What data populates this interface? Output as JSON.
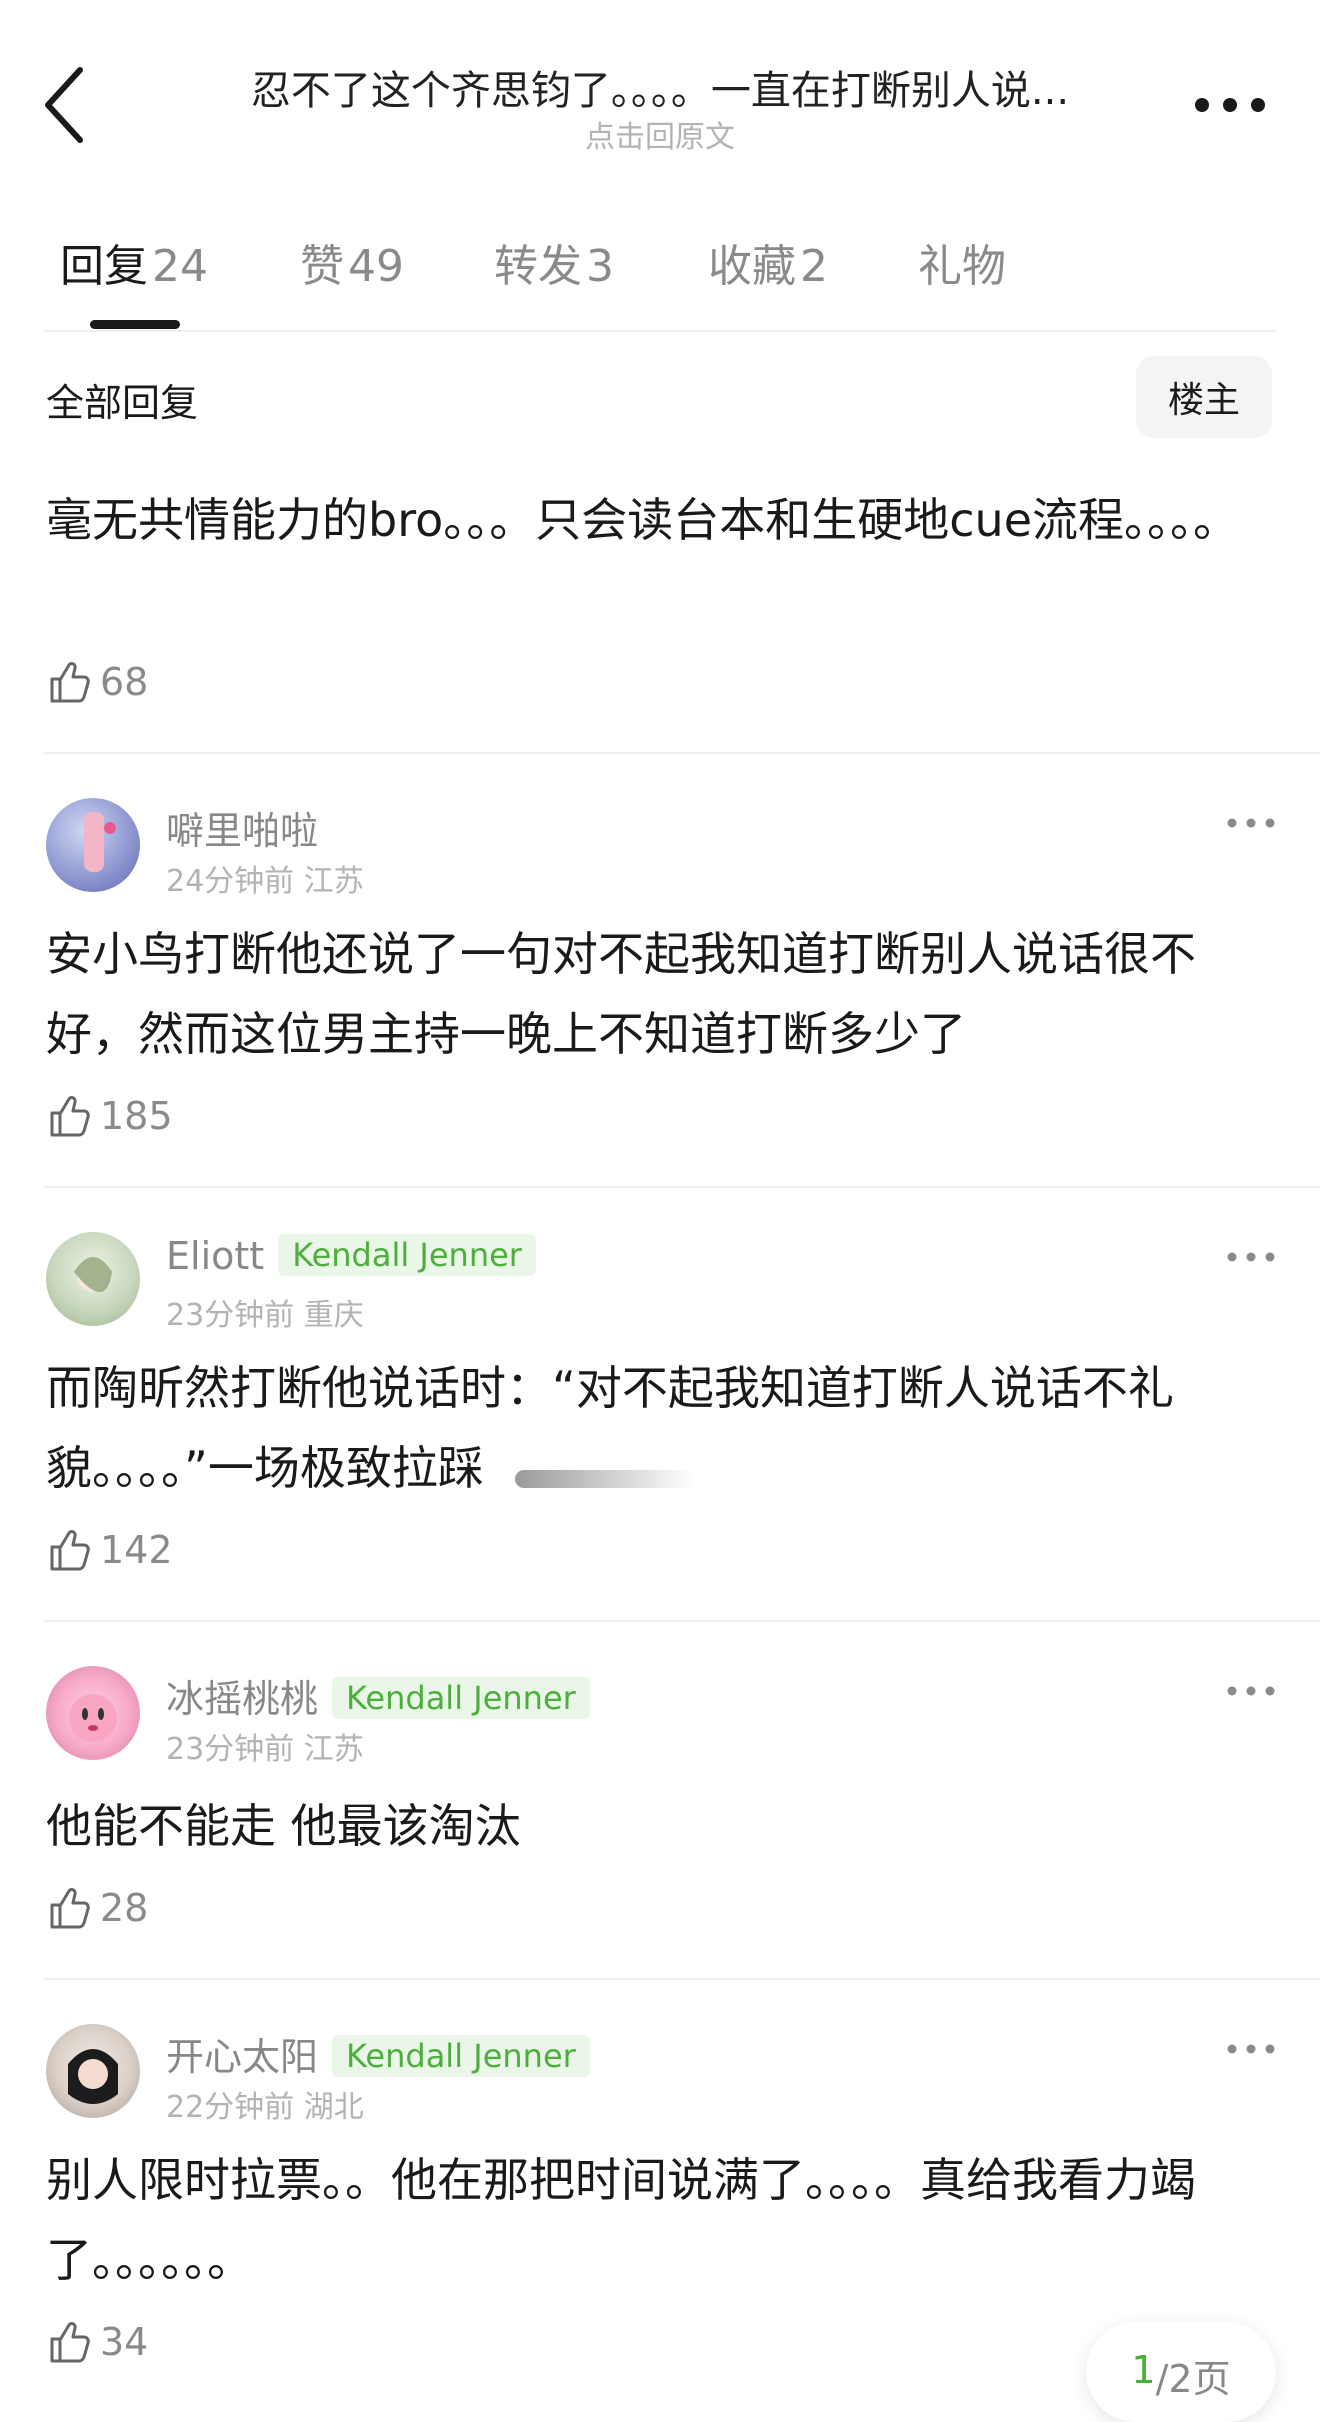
{
  "header": {
    "title": "忍不了这个齐思钧了。。。。一直在打断别人说...",
    "subtitle": "点击回原文"
  },
  "tabs": [
    {
      "label": "回复",
      "count": "24"
    },
    {
      "label": "赞",
      "count": "49"
    },
    {
      "label": "转发",
      "count": "3"
    },
    {
      "label": "收藏",
      "count": "2"
    },
    {
      "label": "礼物",
      "count": ""
    }
  ],
  "section": {
    "title": "全部回复",
    "filter_button": "楼主"
  },
  "comments": [
    {
      "user": "",
      "badge": "",
      "time": "",
      "location": "",
      "text": "毫无共情能力的bro。。。只会读台本和生硬地cue流程。。。。",
      "likes": "68"
    },
    {
      "user": "噼里啪啦",
      "badge": "",
      "time": "24分钟前",
      "location": "江苏",
      "text": "安小鸟打断他还说了一句对不起我知道打断别人说话很不好，然而这位男主持一晚上不知道打断多少了",
      "likes": "185"
    },
    {
      "user": "Eliott",
      "badge": "Kendall Jenner",
      "time": "23分钟前",
      "location": "重庆",
      "text": "而陶昕然打断他说话时：“对不起我知道打断人说话不礼貌。。。。”一场极致拉踩",
      "likes": "142"
    },
    {
      "user": "冰摇桃桃",
      "badge": "Kendall Jenner",
      "time": "23分钟前",
      "location": "江苏",
      "text": "他能不能走 他最该淘汰",
      "likes": "28"
    },
    {
      "user": "开心太阳",
      "badge": "Kendall Jenner",
      "time": "22分钟前",
      "location": "湖北",
      "text": "别人限时拉票。。他在那把时间说满了。。。。真给我看力竭了。。。。。。",
      "likes": "34"
    }
  ],
  "pager": {
    "current": "1",
    "total": "/2页"
  },
  "colors": {
    "accent_green": "#4caf3c",
    "badge_bg": "#eaf7e8",
    "muted": "#8a8a8a"
  }
}
